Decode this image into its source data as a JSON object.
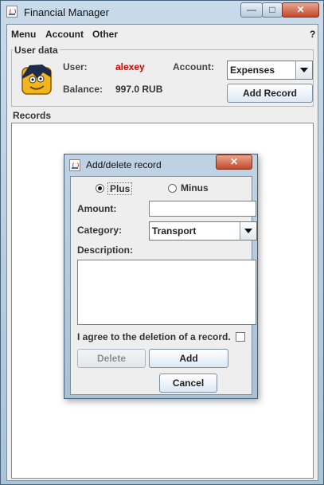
{
  "window": {
    "title": "Financial Manager",
    "controls": {
      "minimize": "—",
      "maximize": "□",
      "close": "✕"
    }
  },
  "menu": {
    "items": [
      "Menu",
      "Account",
      "Other"
    ],
    "help": "?"
  },
  "user_panel": {
    "title": "User data",
    "user_label": "User:",
    "user_name": "alexey",
    "account_label": "Account:",
    "account_value": "Expenses",
    "balance_label": "Balance:",
    "balance_value": "997.0 RUB",
    "add_record_label": "Add Record"
  },
  "records_panel": {
    "title": "Records"
  },
  "dialog": {
    "title": "Add/delete record",
    "close": "✕",
    "plus_label": "Plus",
    "minus_label": "Minus",
    "amount_label": "Amount:",
    "amount_value": "",
    "category_label": "Category:",
    "category_value": "Transport",
    "description_label": "Description:",
    "description_value": "",
    "agree_label": "I agree to the deletion of a record.",
    "delete_label": "Delete",
    "add_label": "Add",
    "cancel_label": "Cancel",
    "plus_selected": true
  },
  "colors": {
    "user_name": "#d80000",
    "close_button": "#c34a2d",
    "title_gradient": "#a9c3d8"
  },
  "icons": [
    "java-app-icon",
    "minimize-icon",
    "maximize-icon",
    "close-icon",
    "user-avatar-icon",
    "dropdown-arrow-icon"
  ]
}
